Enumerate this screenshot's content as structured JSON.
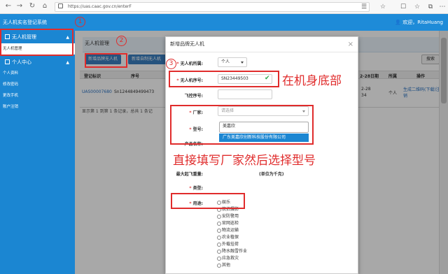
{
  "browser": {
    "url": "https://uas.caac.gov.cn/enterF",
    "back_icon": "arrow-left-icon",
    "forward_icon": "arrow-right-icon",
    "reload_icon": "reload-icon",
    "home_icon": "home-icon"
  },
  "app": {
    "title": "无人机实名登记系统",
    "user_greeting": "欢迎，RitaHuang"
  },
  "sidebar": {
    "groups": [
      {
        "label": "无人机管理",
        "items": [
          "无人机管理"
        ]
      },
      {
        "label": "个人中心",
        "items": [
          "个人资料",
          "修改密码",
          "更改手机",
          "账户注销"
        ]
      }
    ]
  },
  "main": {
    "section_title": "无人机管理",
    "buttons": {
      "new_product": "新增品牌无人机",
      "new_custom": "新增自制无人机"
    },
    "search_label": "搜索",
    "table": {
      "headers": [
        "登记标识",
        "序号",
        "2-28日期",
        "所属",
        "操作"
      ],
      "row": {
        "id": "UAS00007680",
        "serial": "Sn1244849499473",
        "date_part1": "2-28",
        "date_part2": "34",
        "owner": "个人",
        "op": "生成二维码(下载)注销"
      },
      "pager": "显示第 1 到第 1 条记录，总共 1 条记"
    }
  },
  "dialog": {
    "title": "新增品牌无人机",
    "close_icon": "close-icon",
    "fields": {
      "owner_label": "无人机所属:",
      "owner_value": "个人",
      "serial_label": "无人机序号:",
      "serial_value": "SN23449503",
      "fc_label": "飞控序号:",
      "maker_label": "厂家:",
      "maker_placeholder": "请选择",
      "model_label": "型号:",
      "model_value": "美嘉欣",
      "model_option": "广东美嘉欣创新科技股份有限公司",
      "product_label": "产品名称:",
      "mtow_label": "最大起飞重量:",
      "mtow_unit": "(单位为千克)",
      "type_label": "类型:",
      "use_label": "用途:"
    },
    "uses": [
      "娱乐",
      "航拍摄影",
      "安防警用",
      "官网巡检",
      "物流运输",
      "农业植保",
      "外载挂荷",
      "降水融雪作业",
      "应急救灾",
      "其他"
    ]
  },
  "annotations": {
    "n1": "1",
    "n2": "2",
    "n3": "3",
    "text_bottom": "在机身底部",
    "text_maker": "直接填写厂家然后选择型号"
  },
  "colors": {
    "accent": "#1e8bd8",
    "annotation": "#e02c2c"
  }
}
